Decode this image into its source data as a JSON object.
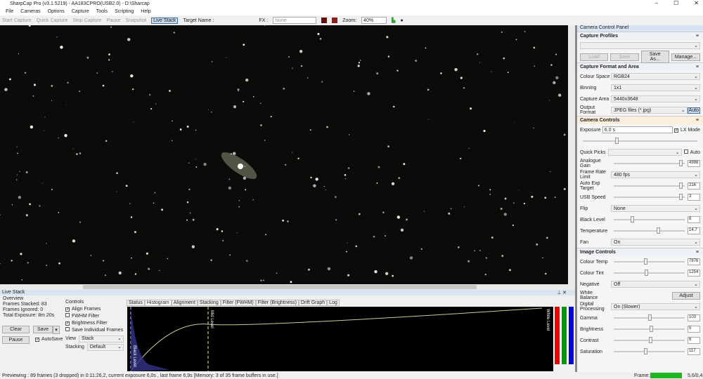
{
  "window": {
    "title": "SharpCap Pro (v3.1.5219) - AA183CPRO(USB2.0) - D:\\Sharcap",
    "min": "–",
    "max": "☐",
    "close": "✕"
  },
  "menu": [
    "File",
    "Cameras",
    "Options",
    "Capture",
    "Tools",
    "Scripting",
    "Help"
  ],
  "toolbar": {
    "start": "Start Capture",
    "quick": "Quick Capture",
    "stop": "Stop Capture",
    "pause": "Pause",
    "snapshot": "Snapshot",
    "live": "Live Stack",
    "target": "Target Name :",
    "fx_label": "FX :",
    "fx_value": "None",
    "zoom_label": "Zoom:",
    "zoom_value": "40%"
  },
  "panel": {
    "title": "Camera Control Panel",
    "profiles": {
      "title": "Capture Profiles",
      "load": "Load",
      "save": "Save",
      "save_as": "Save As...",
      "manage": "Manage..."
    },
    "format": {
      "title": "Capture Format and Area",
      "colour_space_label": "Colour Space",
      "colour_space": "RGB24",
      "binning_label": "Binning",
      "binning": "1x1",
      "area_label": "Capture Area",
      "area": "5440x3648",
      "output_label": "Output Format",
      "output": "JPEG files (*.jpg)",
      "auto": "Auto"
    },
    "camera": {
      "title": "Camera Controls",
      "exposure_label": "Exposure",
      "exposure": "6.0 s",
      "lx": "LX Mode",
      "quick_label": "Quick Picks",
      "auto": "Auto",
      "gain_label": "Analogue Gain",
      "gain": "4998",
      "gain_pos": 0.97,
      "fps_label": "Frame Rate Limit",
      "fps": "480 fps",
      "aet_label": "Auto Exp Target",
      "aet": "216",
      "aet_pos": 0.97,
      "usb_label": "USB Speed",
      "usb": "3",
      "usb_pos": 0.97,
      "flip_label": "Flip",
      "flip": "None",
      "black_label": "Black Level",
      "black": "8",
      "black_pos": 0.25,
      "temp_label": "Temperature",
      "temp": "14.7",
      "temp_pos": 0.64,
      "fan_label": "Fan",
      "fan": "On"
    },
    "image": {
      "title": "Image Controls",
      "ct_label": "Colour Temp",
      "ct": "7876",
      "ct_pos": 0.45,
      "tint_label": "Colour Tint",
      "tint": "1254",
      "tint_pos": 0.46,
      "neg_label": "Negative",
      "neg": "Off",
      "wb_label": "White Balance",
      "adjust": "Adjust",
      "dp_label": "Digital Processing",
      "dp": "On (Slower)",
      "gamma_label": "Gamma",
      "gamma": "103",
      "gamma_pos": 0.51,
      "bright_label": "Brightness",
      "bright": "5",
      "bright_pos": 0.53,
      "contrast_label": "Contrast",
      "contrast": "6",
      "contrast_pos": 0.52,
      "sat_label": "Saturation",
      "sat": "117",
      "sat_pos": 0.45
    }
  },
  "livestack": {
    "title": "Live Stack",
    "overview": "Overview",
    "stacked": "Frames Stacked: 83",
    "ignored": "Frames Ignored: 0",
    "total": "Total Exposure: 8m 20s",
    "clear": "Clear",
    "save": "Save",
    "pause": "Pause",
    "autosave": "AutoSave",
    "controls": "Controls",
    "align": "Align Frames",
    "fwhm": "FWHM Filter",
    "brightness": "Brightness Filter",
    "individual": "Save Individual Frames",
    "view_label": "View",
    "view": "Stack",
    "stacking_label": "Stacking",
    "stacking": "Default",
    "tabs": [
      "Status",
      "Histogram",
      "Alignment",
      "Stacking",
      "Filter (FWHM)",
      "Filter (Brightness)",
      "Drift Graph",
      "Log"
    ],
    "active_tab": "Histogram",
    "black_level": "Black Level",
    "mid_level": "Mid Level",
    "white_level": "White Level"
  },
  "status": {
    "text": "Previewing : 89 frames (3 dropped) in 0:11:26,2, current exposure 6,0s , last frame 6,9s  [Memory: 3 of 35 frame buffers in use.]",
    "frame_label": "Frame:",
    "frame_value": "5,6/0,4",
    "frame_color": "#1fb51f"
  }
}
